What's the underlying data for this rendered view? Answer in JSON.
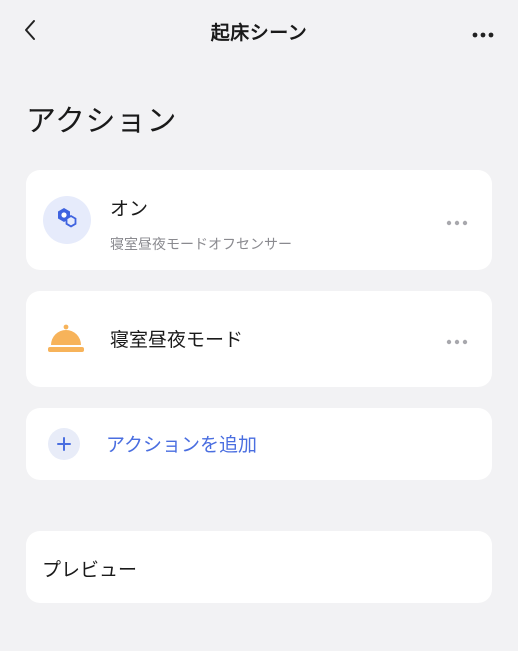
{
  "header": {
    "title": "起床シーン",
    "back_icon": "chevron-left-icon",
    "more_icon": "more-horizontal-icon"
  },
  "page": {
    "title": "アクション"
  },
  "actions": [
    {
      "title": "オン",
      "subtitle": "寝室昼夜モードオフセンサー",
      "icon": "device-hexagon-icon"
    },
    {
      "title": "寝室昼夜モード",
      "icon": "service-bell-icon"
    }
  ],
  "add_action": {
    "label": "アクションを追加",
    "icon": "plus-icon"
  },
  "preview": {
    "label": "プレビュー"
  },
  "colors": {
    "accent": "#4a6ee0",
    "background": "#f2f2f4",
    "card": "#ffffff",
    "bell": "#f7b35a"
  }
}
